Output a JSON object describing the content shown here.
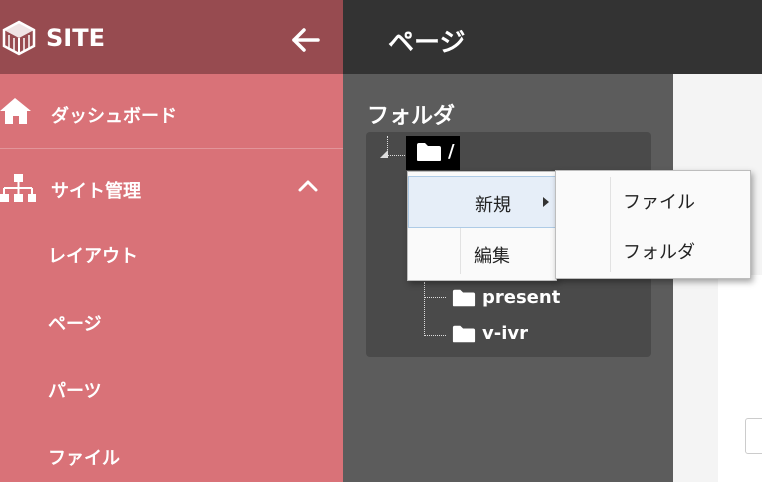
{
  "app": {
    "site_title": "SITE",
    "page_title": "ページ"
  },
  "sidebar": {
    "dashboard_label": "ダッシュボード",
    "site_admin_label": "サイト管理",
    "sub_items": [
      {
        "label": "レイアウト"
      },
      {
        "label": "ページ"
      },
      {
        "label": "パーツ"
      },
      {
        "label": "ファイル"
      }
    ]
  },
  "main": {
    "folder_heading": "フォルダ",
    "tree": {
      "root_label": "/",
      "children": [
        {
          "label": "present"
        },
        {
          "label": "v-ivr"
        }
      ]
    }
  },
  "context_menu": {
    "items": [
      {
        "label": "新規"
      },
      {
        "label": "編集"
      }
    ],
    "submenu": {
      "items": [
        {
          "label": "ファイル"
        },
        {
          "label": "フォルダ"
        }
      ]
    }
  },
  "colors": {
    "sidebar_bg": "#d97278",
    "sidebar_header_bg": "#974b50",
    "topbar_bg": "#333333",
    "main_bg": "#5c5c5c",
    "menu_highlight": "#e6eef8"
  }
}
